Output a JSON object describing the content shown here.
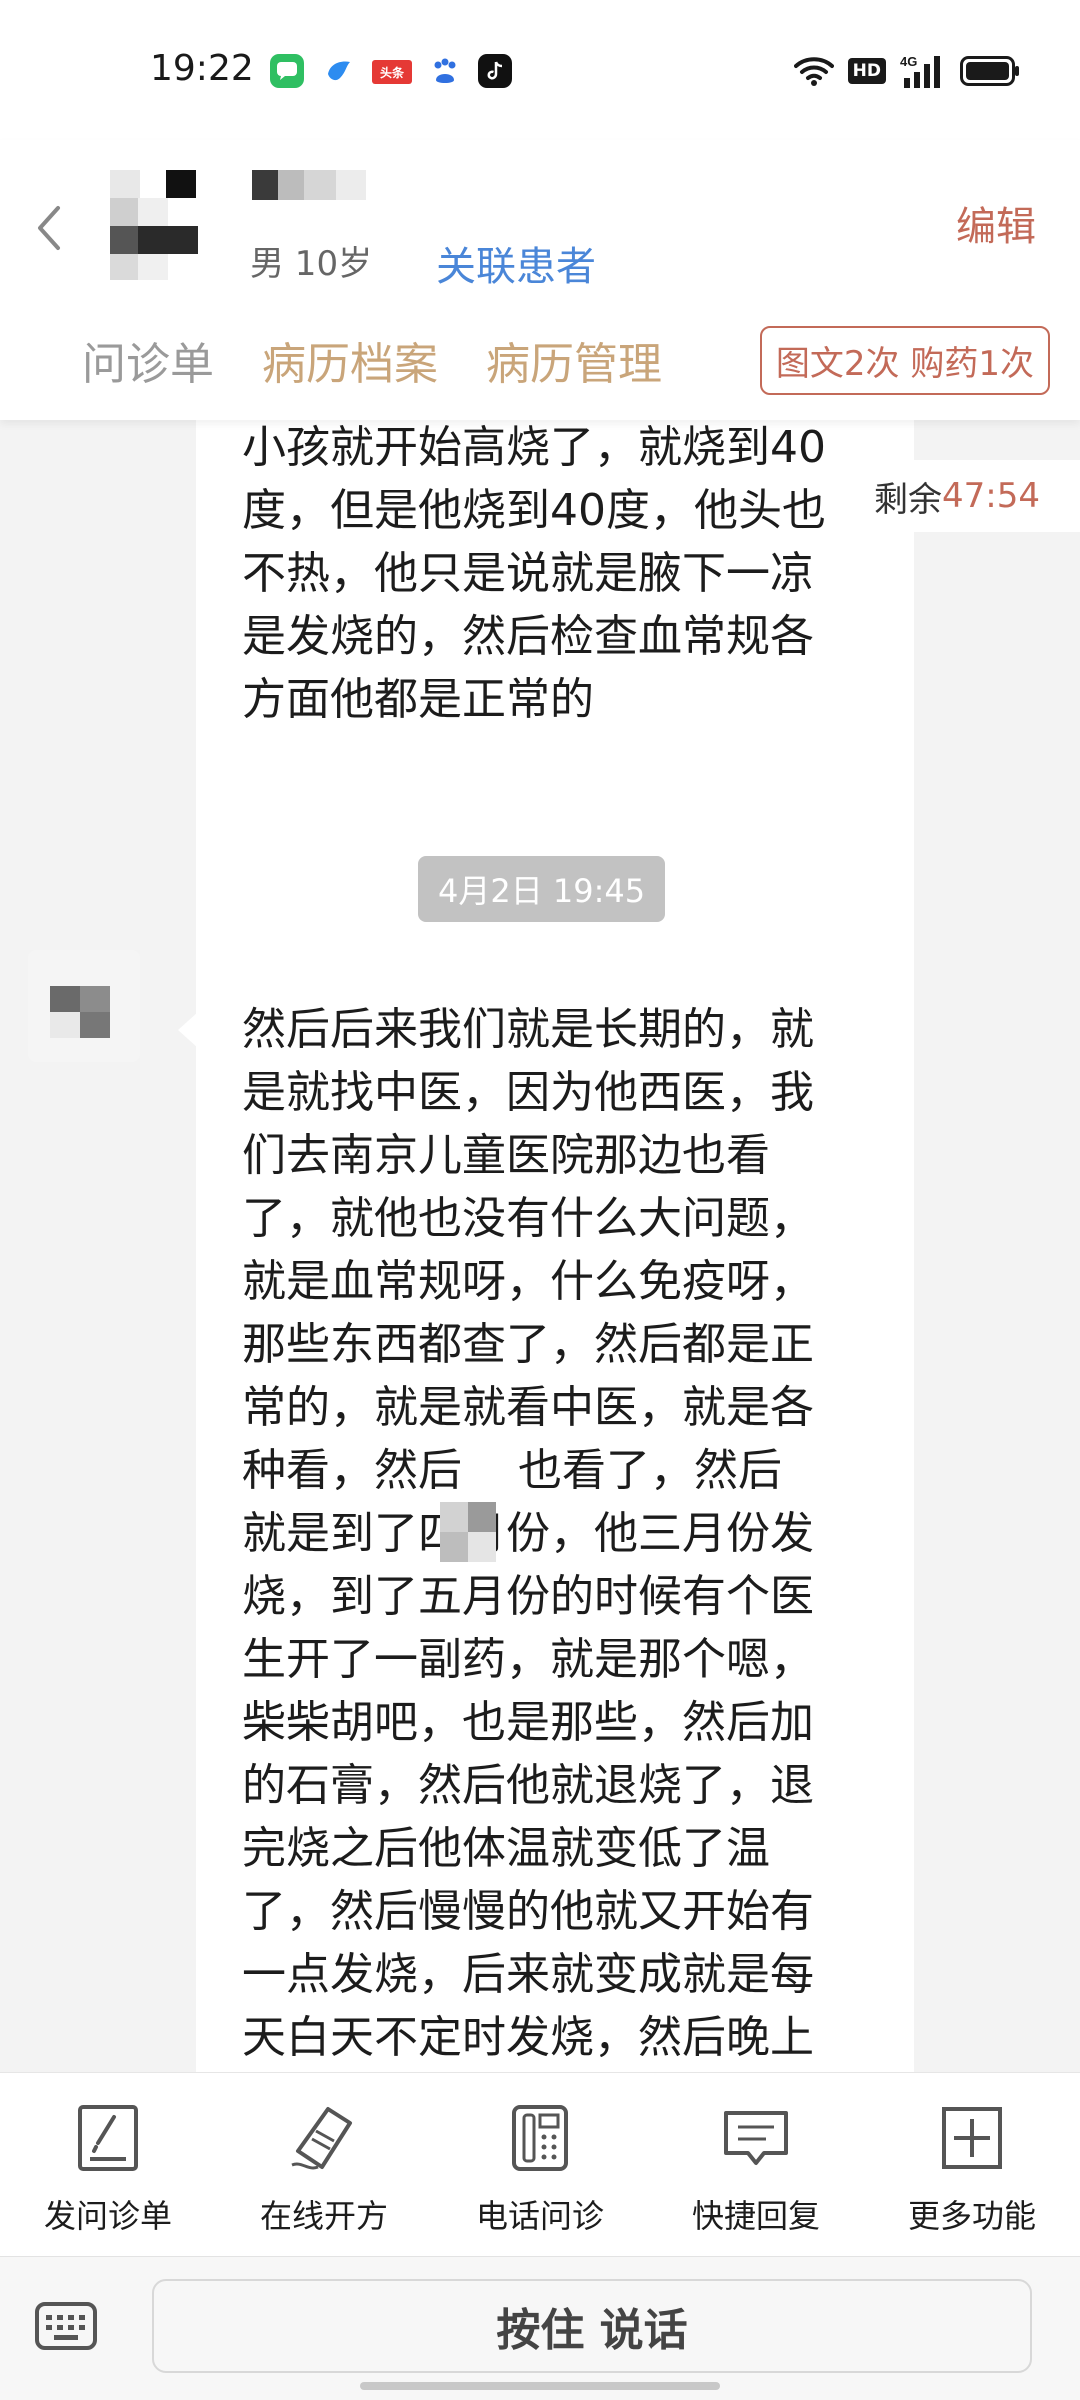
{
  "status_bar": {
    "time": "19:22",
    "app_icons": [
      "messages-icon",
      "blue-bird-icon",
      "toutiao-icon",
      "baidu-icon",
      "tiktok-icon"
    ],
    "toutiao_text": "头条",
    "hd": "HD",
    "network": "4G"
  },
  "header": {
    "patient_info": "男 10岁",
    "link_label": "关联患者",
    "edit_label": "编辑",
    "tabs": [
      {
        "label": "问诊单"
      },
      {
        "label": "病历档案"
      },
      {
        "label": "病历管理"
      }
    ],
    "quota_badge": "图文2次 购药1次"
  },
  "chat": {
    "timer_label": "剩余",
    "timer_value": "47:54",
    "messages": [
      {
        "text": "小孩就开始高烧了，就烧到40\n度，但是他烧到40度，他头也\n不热，他只是说就是腋下一凉\n是发烧的，然后检查血常规各\n方面他都是正常的"
      },
      {
        "text": "然后后来我们就是长期的，就\n是就找中医，因为他西医，我\n们去南京儿童医院那边也看\n了，就他也没有什么大问题，\n就是血常规呀，什么免疫呀，\n那些东西都查了，然后都是正\n常的，就是就看中医，就是各\n种看，然后    也看了，然后\n就是到了四月份，他三月份发\n烧，到了五月份的时候有个医\n生开了一副药，就是那个嗯，\n柴柴胡吧，也是那些，然后加\n的石膏，然后他就退烧了，退\n完烧之后他体温就变低了温\n了，然后慢慢的他就又开始有\n一点发烧，后来就变成就是每\n天白天不定时发烧，然后晚上"
      }
    ],
    "timestamp": "4月2日 19:45"
  },
  "toolbar": {
    "items": [
      {
        "label": "发问诊单",
        "icon": "form-icon"
      },
      {
        "label": "在线开方",
        "icon": "prescription-icon"
      },
      {
        "label": "电话问诊",
        "icon": "phone-icon"
      },
      {
        "label": "快捷回复",
        "icon": "quick-reply-icon"
      },
      {
        "label": "更多功能",
        "icon": "plus-icon"
      }
    ]
  },
  "input": {
    "voice_label": "按住 说话"
  },
  "colors": {
    "accent": "#c36a58",
    "link": "#4a86d8",
    "gold": "#c9a57a",
    "background": "#f3f3f3"
  }
}
